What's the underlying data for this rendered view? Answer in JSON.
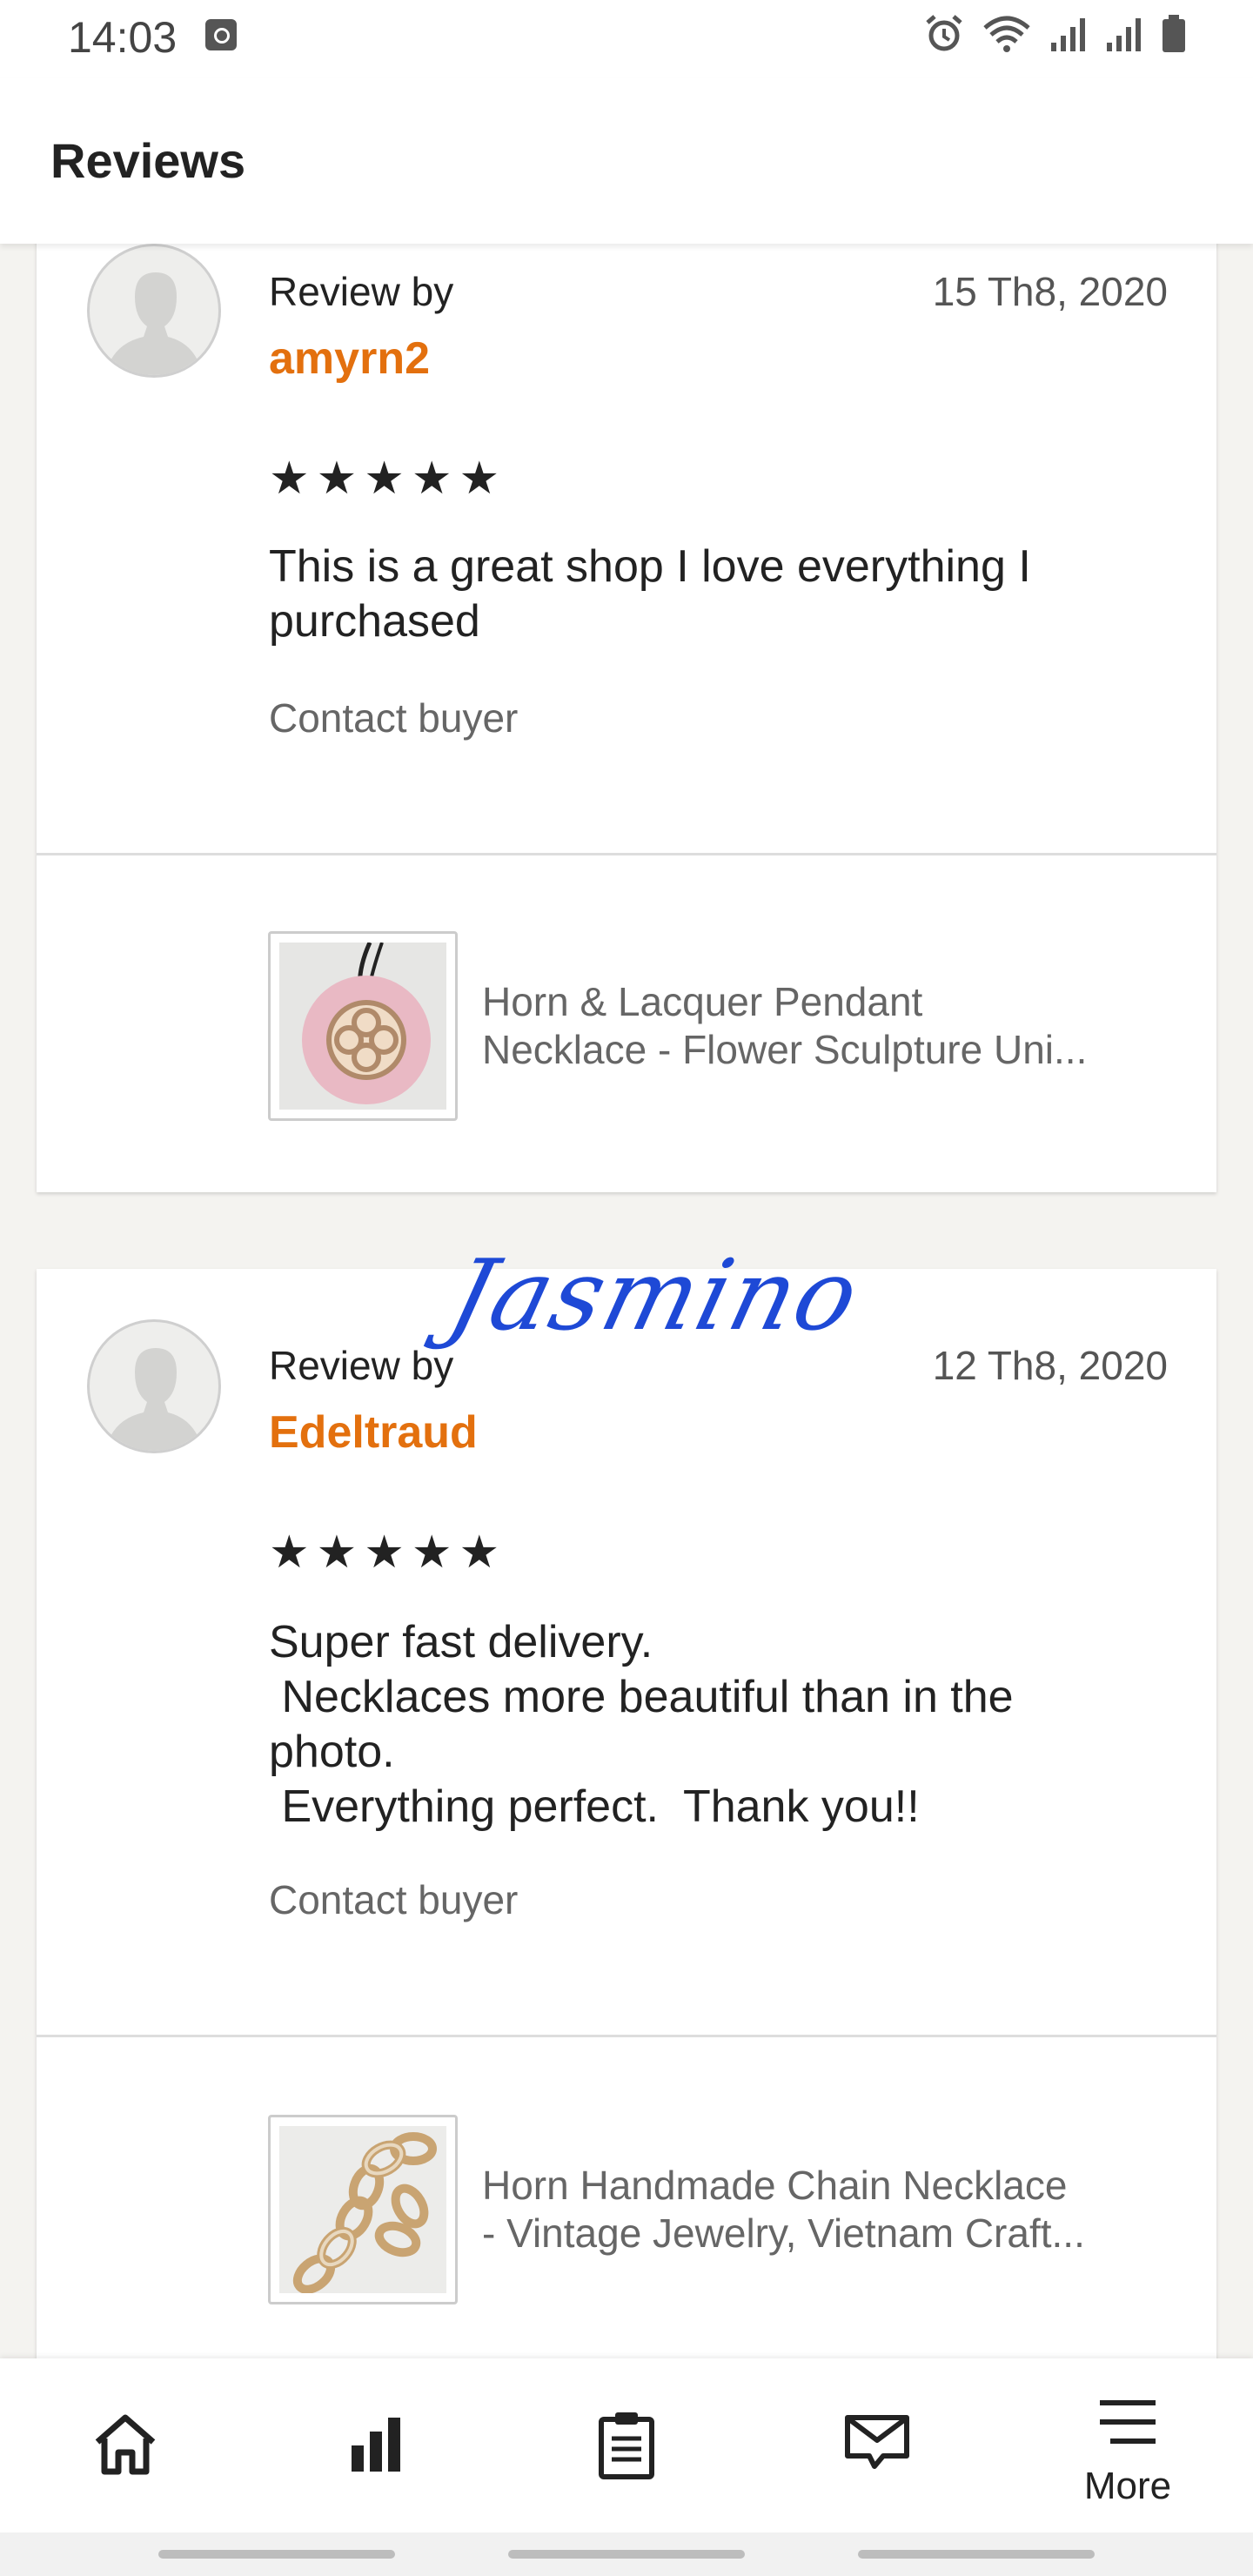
{
  "status_bar": {
    "time": "14:03",
    "icons": [
      "clock-badge-icon",
      "alarm-icon",
      "wifi-icon",
      "signal-icon",
      "signal-icon",
      "battery-icon"
    ]
  },
  "header": {
    "title": "Reviews"
  },
  "reviews": [
    {
      "review_by_label": "Review by",
      "reviewer": "amyrn2",
      "date": "15 Th8, 2020",
      "stars": "★★★★★",
      "rating": 5,
      "text": "This is a great shop I love everything I\npurchased",
      "contact_label": "Contact buyer",
      "listing_line1": "Horn & Lacquer Pendant",
      "listing_line2": "Necklace - Flower Sculpture Uni..."
    },
    {
      "review_by_label": "Review by",
      "reviewer": "Edeltraud",
      "date": "12 Th8, 2020",
      "stars": "★★★★★",
      "rating": 5,
      "text": "Super fast delivery.\n Necklaces more beautiful than in the\nphoto.\n Everything perfect.  Thank you!!",
      "contact_label": "Contact buyer",
      "listing_line1": "Horn Handmade Chain Necklace",
      "listing_line2": "- Vintage Jewelry, Vietnam Craft..."
    }
  ],
  "signature_text": "Jasmino",
  "bottom_nav": {
    "items": [
      {
        "name": "home",
        "icon": "home-icon"
      },
      {
        "name": "stats",
        "icon": "bar-chart-icon"
      },
      {
        "name": "orders",
        "icon": "clipboard-icon"
      },
      {
        "name": "messages",
        "icon": "mail-icon"
      },
      {
        "name": "more",
        "icon": "menu-icon",
        "label": "More"
      }
    ]
  },
  "colors": {
    "reviewer": "#e3700e",
    "signature": "#1e49d6",
    "background": "#f4f3f0"
  }
}
